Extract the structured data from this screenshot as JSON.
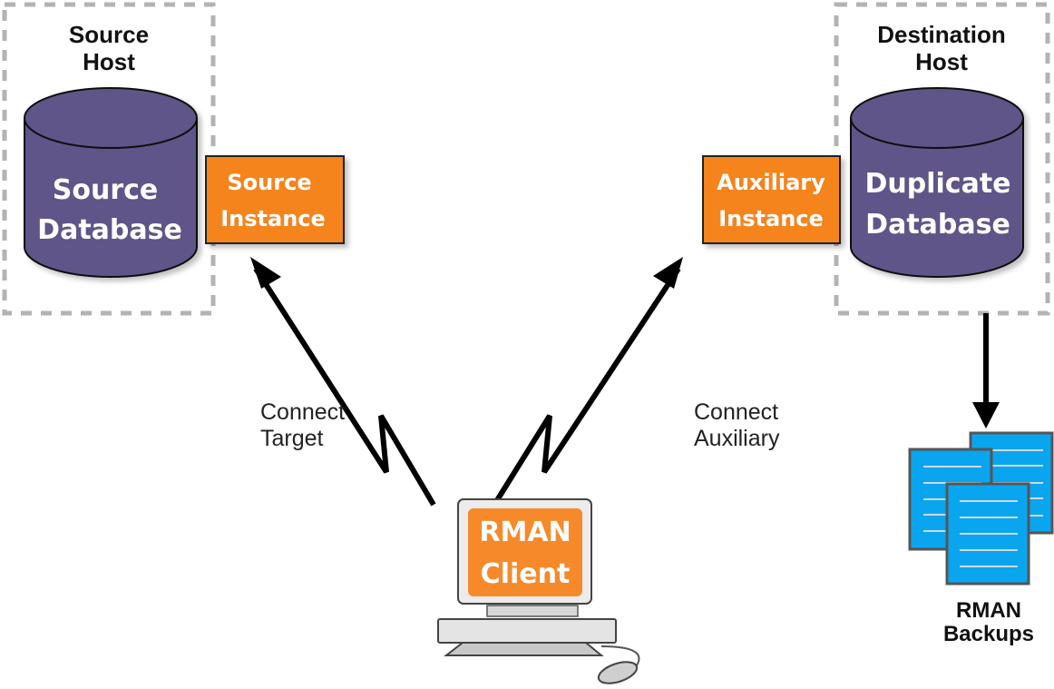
{
  "colors": {
    "database": "#5f5588",
    "instance": "#f5841f",
    "backup_page": "#0aa5ef",
    "host_border": "#b3b3b3",
    "arrow": "#000000"
  },
  "source_host": {
    "label_line1": "Source",
    "label_line2": "Host",
    "database": {
      "line1": "Source",
      "line2": "Database"
    },
    "instance": {
      "line1": "Source",
      "line2": "Instance"
    }
  },
  "destination_host": {
    "label_line1": "Destination",
    "label_line2": "Host",
    "database": {
      "line1": "Duplicate",
      "line2": "Database"
    },
    "instance": {
      "line1": "Auxiliary",
      "line2": "Instance"
    }
  },
  "connections": {
    "target": {
      "line1": "Connect",
      "line2": "Target"
    },
    "auxiliary": {
      "line1": "Connect",
      "line2": "Auxiliary"
    }
  },
  "client": {
    "line1": "RMAN",
    "line2": "Client"
  },
  "backups": {
    "line1": "RMAN",
    "line2": "Backups"
  }
}
